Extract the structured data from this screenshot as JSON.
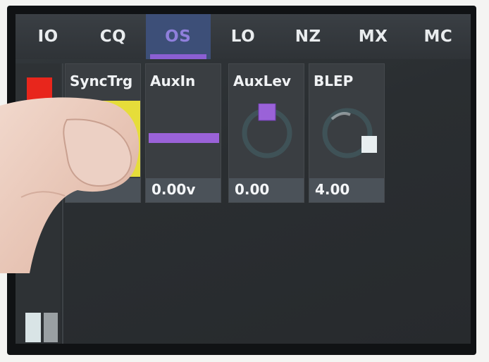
{
  "tabs": [
    {
      "label": "IO",
      "active": false
    },
    {
      "label": "CQ",
      "active": false
    },
    {
      "label": "OS",
      "active": true
    },
    {
      "label": "LO",
      "active": false
    },
    {
      "label": "NZ",
      "active": false
    },
    {
      "label": "MX",
      "active": false
    },
    {
      "label": "MC",
      "active": false
    }
  ],
  "panels": {
    "synctrg": {
      "title": "SyncTrg"
    },
    "auxin": {
      "title": "AuxIn",
      "value": "0.00v"
    },
    "auxlev": {
      "title": "AuxLev",
      "value": "0.00",
      "knob_position": 0.0
    },
    "blep": {
      "title": "BLEP",
      "value": "4.00",
      "knob_position": 0.35
    }
  },
  "colors": {
    "active_tab_bg": "#3d4f78",
    "active_tab_text": "#8f7fdc",
    "accent_purple": "#8b5fd3",
    "trigger_yellow": "#e6dd3a",
    "status_red": "#e8261c",
    "knob_white_handle": "#e8eef0"
  }
}
